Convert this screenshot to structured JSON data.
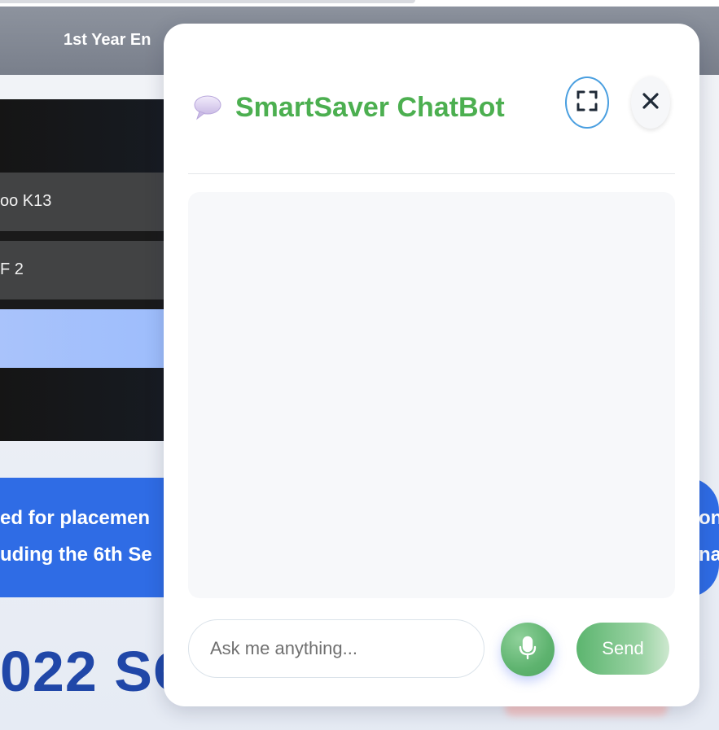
{
  "background_page": {
    "nav_title": "1st Year En",
    "rows": [
      "oo K13",
      "F 2"
    ],
    "banner_left": [
      "ed for placemen",
      "uding the 6th Se"
    ],
    "banner_right": [
      "on",
      "na"
    ],
    "big_heading": "022 SC"
  },
  "chatbot": {
    "title": "SmartSaver ChatBot",
    "title_color": "#4caf50",
    "icons": {
      "header": "speech-bubble-icon",
      "expand": "fullscreen-icon",
      "close": "close-icon",
      "mic": "microphone-icon"
    },
    "input": {
      "placeholder": "Ask me anything...",
      "value": ""
    },
    "send_label": "Send",
    "messages": []
  }
}
